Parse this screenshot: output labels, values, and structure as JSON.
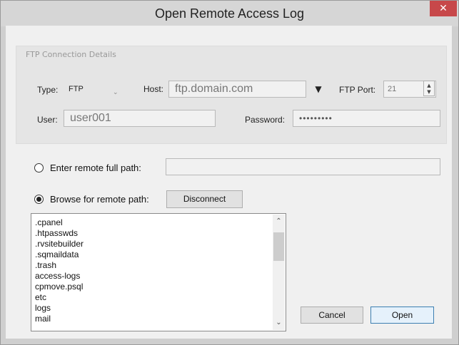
{
  "window": {
    "title": "Open Remote Access Log",
    "close_glyph": "✕"
  },
  "connection": {
    "group_title": "FTP Connection Details",
    "type_label": "Type:",
    "type_value": "FTP",
    "host_label": "Host:",
    "host_value": "ftp.domain.com",
    "port_label": "FTP Port:",
    "port_value": "21",
    "user_label": "User:",
    "user_value": "user001",
    "password_label": "Password:",
    "password_value": "•••••••••"
  },
  "path": {
    "enter_label": "Enter remote full path:",
    "enter_value": "",
    "browse_label": "Browse for remote path:",
    "selected": "browse",
    "disconnect_label": "Disconnect"
  },
  "file_list": {
    "items": [
      ".cpanel",
      ".htpasswds",
      ".rvsitebuilder",
      ".sqmaildata",
      ".trash",
      "access-logs",
      "cpmove.psql",
      "etc",
      "logs",
      "mail"
    ],
    "scroll_position": 0.08
  },
  "footer": {
    "cancel_label": "Cancel",
    "open_label": "Open"
  },
  "icons": {
    "close": "close-icon",
    "dropdown": "chevron-down-icon",
    "host_dropdown": "triangle-down-icon",
    "spin_up": "spin-up-icon",
    "spin_down": "spin-down-icon",
    "scroll_up": "scroll-up-icon",
    "scroll_down": "scroll-down-icon"
  },
  "colors": {
    "close_button": "#c7484a",
    "default_button_border": "#3c7fb1"
  }
}
